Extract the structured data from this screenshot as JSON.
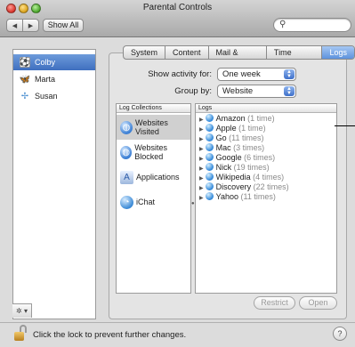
{
  "window": {
    "title": "Parental Controls"
  },
  "toolbar": {
    "back_icon": "back-arrow-icon",
    "forward_icon": "forward-arrow-icon",
    "back_glyph": "◀",
    "forward_glyph": "▶",
    "show_all_label": "Show All",
    "search_placeholder": ""
  },
  "sidebar": {
    "items": [
      {
        "label": "Colby",
        "icon": "colby-avatar-icon",
        "glyph": "⚽",
        "selected": true
      },
      {
        "label": "Marta",
        "icon": "butterfly-icon",
        "glyph": "🦋",
        "selected": false
      },
      {
        "label": "Susan",
        "icon": "dragonfly-icon",
        "glyph": "✢",
        "selected": false
      }
    ],
    "action_label": "✲ ▾"
  },
  "tabs": [
    {
      "label": "System",
      "active": false
    },
    {
      "label": "Content",
      "active": false
    },
    {
      "label": "Mail & iChat",
      "active": false
    },
    {
      "label": "Time Limits",
      "active": false
    },
    {
      "label": "Logs",
      "active": true
    }
  ],
  "filters": {
    "show_activity_label": "Show activity for:",
    "show_activity_value": "One week",
    "group_by_label": "Group by:",
    "group_by_value": "Website"
  },
  "collections": {
    "header": "Log Collections",
    "items": [
      {
        "label": "Websites Visited",
        "icon": "globe-icon",
        "selected": true
      },
      {
        "label": "Websites Blocked",
        "icon": "globe-blocked-icon",
        "selected": false
      },
      {
        "label": "Applications",
        "icon": "applications-icon",
        "selected": false
      },
      {
        "label": "iChat",
        "icon": "ichat-icon",
        "selected": false
      }
    ]
  },
  "logs": {
    "header": "Logs",
    "items": [
      {
        "site": "Amazon",
        "count": "(1 time)"
      },
      {
        "site": "Apple",
        "count": "(1 time)"
      },
      {
        "site": "Go",
        "count": "(11 times)"
      },
      {
        "site": "Mac",
        "count": "(3 times)"
      },
      {
        "site": "Google",
        "count": "(6 times)"
      },
      {
        "site": "Nick",
        "count": "(19 times)"
      },
      {
        "site": "Wikipedia",
        "count": "(4 times)"
      },
      {
        "site": "Discovery",
        "count": "(22 times)"
      },
      {
        "site": "Yahoo",
        "count": "(11 times)"
      }
    ]
  },
  "buttons": {
    "restrict_label": "Restrict",
    "open_label": "Open"
  },
  "footer": {
    "lock_text": "Click the lock to prevent further changes.",
    "help_label": "?"
  },
  "colors": {
    "selection": "#3f6fbf",
    "tab_active": "#5d92dd",
    "count_text": "#8a8a8a"
  }
}
